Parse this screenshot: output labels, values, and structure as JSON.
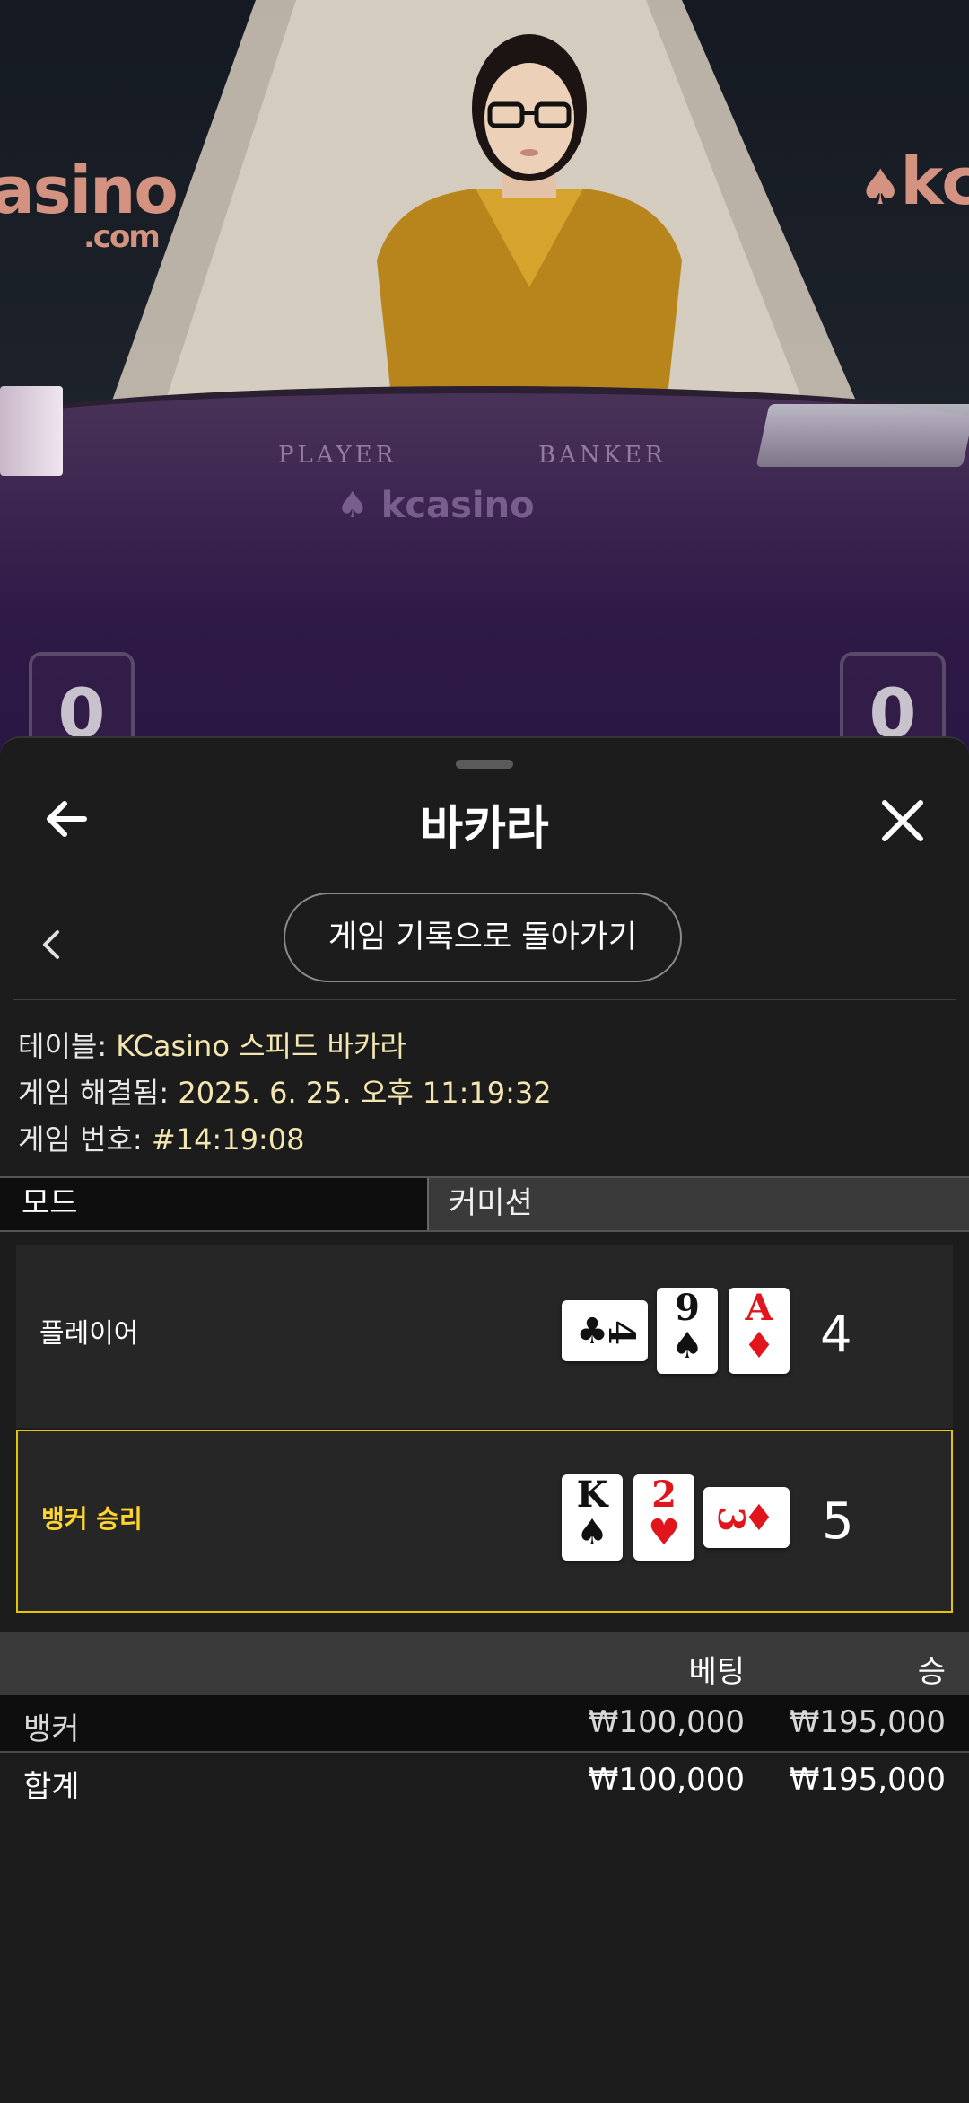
{
  "video": {
    "wall_logo_left": "asino",
    "wall_logo_left_sub": ".com",
    "wall_logo_right": "kc",
    "felt_player": "PLAYER",
    "felt_banker": "BANKER",
    "felt_logo": "kcasino",
    "score_player": "0",
    "score_banker": "0"
  },
  "header": {
    "title": "바카라"
  },
  "history_button": "게임 기록으로 돌아가기",
  "info": {
    "table_label": "테이블: ",
    "table_value": "KCasino 스피드 바카라",
    "resolved_label": "게임 해결됨: ",
    "resolved_value": "2025. 6. 25. 오후 11:19:32",
    "number_label": "게임 번호: ",
    "number_value": "#14:19:08"
  },
  "tabs": {
    "mode": "모드",
    "commission": "커미션"
  },
  "hands": {
    "player": {
      "label": "플레이어",
      "total": "4",
      "cards": [
        {
          "rank": "4",
          "suit": "♣",
          "color": "#111111",
          "orientation": "sideways"
        },
        {
          "rank": "9",
          "suit": "♠",
          "color": "#111111",
          "orientation": "upright"
        },
        {
          "rank": "A",
          "suit": "♦",
          "color": "#e0161c",
          "orientation": "upright"
        }
      ]
    },
    "banker": {
      "label": "뱅커 승리",
      "total": "5",
      "highlight_color": "#e6c400",
      "cards": [
        {
          "rank": "K",
          "suit": "♠",
          "color": "#111111",
          "orientation": "upright"
        },
        {
          "rank": "2",
          "suit": "♥",
          "color": "#e0161c",
          "orientation": "upright"
        },
        {
          "rank": "3",
          "suit": "♦",
          "color": "#e0161c",
          "orientation": "sideways"
        }
      ]
    }
  },
  "results": {
    "columns": {
      "bet": "베팅",
      "win": "승"
    },
    "rows": [
      {
        "label": "뱅커",
        "bet": "₩100,000",
        "win": "₩195,000"
      }
    ],
    "total": {
      "label": "합계",
      "bet": "₩100,000",
      "win": "₩195,000"
    }
  }
}
